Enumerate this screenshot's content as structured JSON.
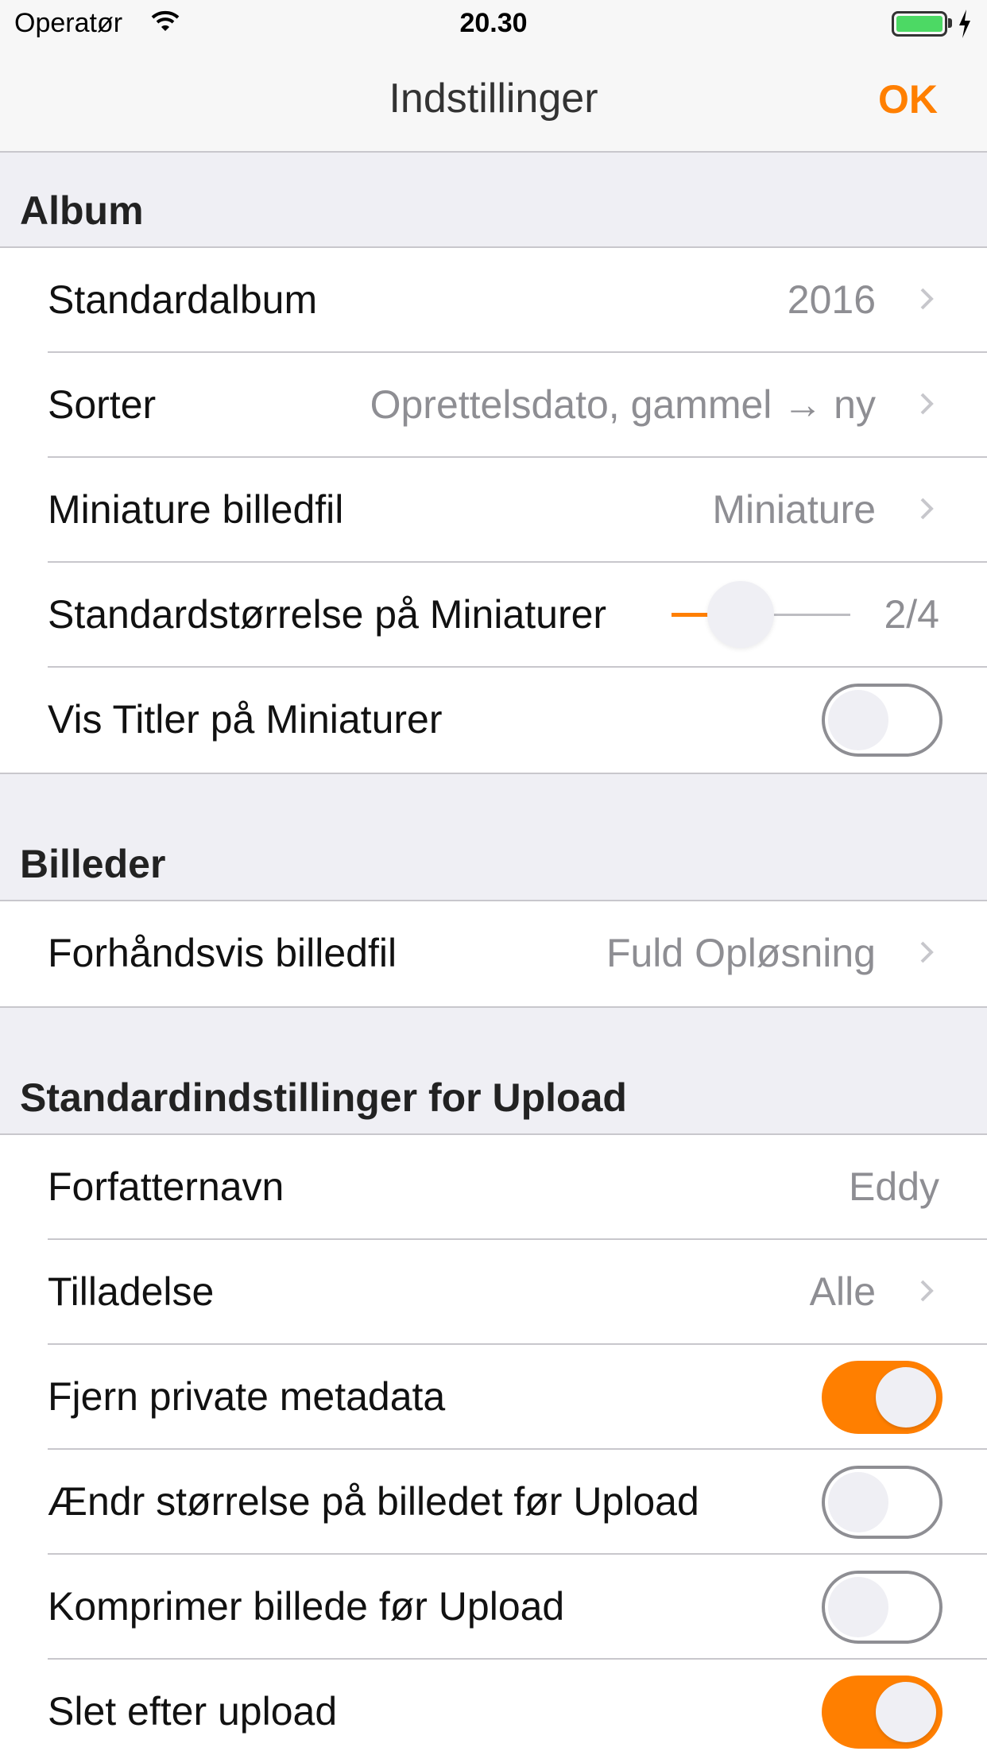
{
  "status": {
    "carrier": "Operatør",
    "time": "20.30"
  },
  "nav": {
    "title": "Indstillinger",
    "ok": "OK"
  },
  "colors": {
    "accent": "#ff7f00",
    "background": "#efeff4",
    "battery": "#4cd964"
  },
  "sections": {
    "album": {
      "header": "Album",
      "standardalbum": {
        "label": "Standardalbum",
        "value": "2016"
      },
      "sorter": {
        "label": "Sorter",
        "value": "Oprettelsdato, gammel → ny"
      },
      "miniature": {
        "label": "Miniature billedfil",
        "value": "Miniature"
      },
      "size": {
        "label": "Standardstørrelse på Miniaturer",
        "value": "2/4",
        "level": 0.25
      },
      "titles": {
        "label": "Vis Titler på Miniaturer",
        "on": false
      }
    },
    "billeder": {
      "header": "Billeder",
      "preview": {
        "label": "Forhåndsvis billedfil",
        "value": "Fuld Opløsning"
      }
    },
    "upload": {
      "header": "Standardindstillinger for Upload",
      "author": {
        "label": "Forfatternavn",
        "value": "Eddy"
      },
      "permission": {
        "label": "Tilladelse",
        "value": "Alle"
      },
      "strip": {
        "label": "Fjern private metadata",
        "on": true
      },
      "resize": {
        "label": "Ændr størrelse på billedet før Upload",
        "on": false
      },
      "compress": {
        "label": "Komprimer billede før Upload",
        "on": false
      },
      "delete": {
        "label": "Slet efter upload",
        "on": true
      }
    }
  }
}
